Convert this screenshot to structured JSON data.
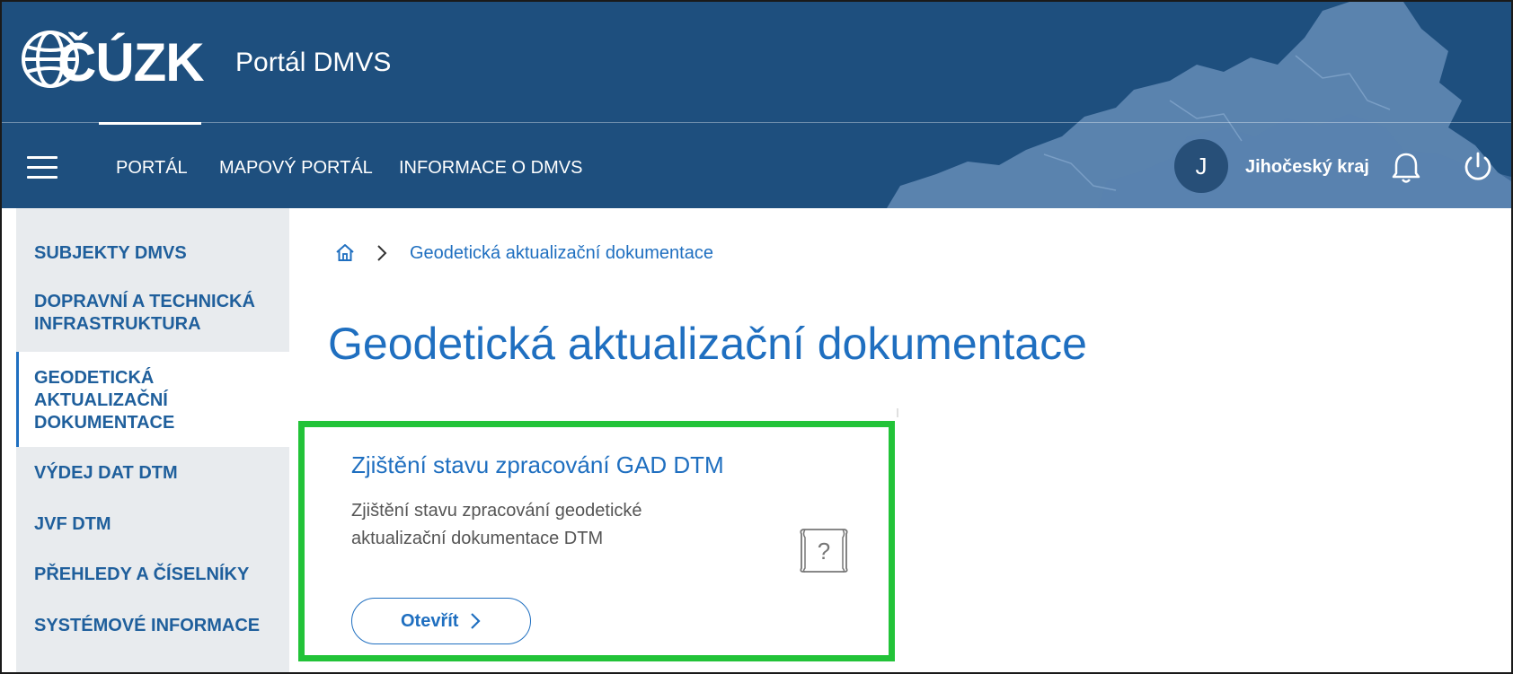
{
  "header": {
    "logo_text": "ČÚZK",
    "portal_title": "Portál DMVS",
    "nav": [
      {
        "label": "PORTÁL",
        "active": true
      },
      {
        "label": "MAPOVÝ PORTÁL"
      },
      {
        "label": "INFORMACE O DMVS"
      }
    ],
    "user": {
      "initial": "J",
      "region": "Jihočeský kraj"
    },
    "icons": {
      "menu": "hamburger-menu-icon",
      "notifications": "bell-icon",
      "logout": "power-icon"
    },
    "colors": {
      "background": "#1e4f7e",
      "map_overlay": "#6f94bf"
    }
  },
  "sidebar": {
    "items": [
      {
        "label": "SUBJEKTY DMVS"
      },
      {
        "label": "DOPRAVNÍ A TECHNICKÁ INFRASTRUKTURA"
      },
      {
        "label": "GEODETICKÁ AKTUALIZAČNÍ DOKUMENTACE",
        "active": true
      },
      {
        "label": "VÝDEJ DAT DTM"
      },
      {
        "label": "JVF DTM"
      },
      {
        "label": "PŘEHLEDY A ČÍSELNÍKY"
      },
      {
        "label": "SYSTÉMOVÉ INFORMACE"
      }
    ]
  },
  "breadcrumb": {
    "home_icon": "home-icon",
    "current": "Geodetická aktualizační dokumentace"
  },
  "main": {
    "title": "Geodetická aktualizační dokumentace",
    "card": {
      "title": "Zjištění stavu zpracování GAD DTM",
      "description": "Zjištění stavu zpracování geodetické aktualizační dokumentace DTM",
      "icon": "map-question-icon",
      "button_label": "Otevřít"
    }
  },
  "colors": {
    "accent": "#1f6fc0",
    "sidebar_bg": "#e8ebee",
    "highlight_border": "#22c338"
  }
}
